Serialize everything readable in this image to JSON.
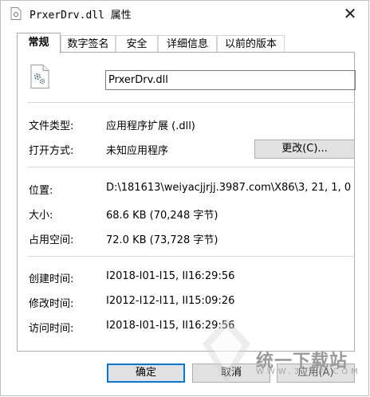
{
  "window": {
    "title_file": "PrxerDrv.dll",
    "title_suffix": "属性",
    "close_glyph": "✕"
  },
  "tabs": [
    {
      "label": "常规",
      "active": true
    },
    {
      "label": "数字签名",
      "active": false
    },
    {
      "label": "安全",
      "active": false
    },
    {
      "label": "详细信息",
      "active": false
    },
    {
      "label": "以前的版本",
      "active": false
    }
  ],
  "general": {
    "file_name": "PrxerDrv.dll",
    "file_icon": "dll-gear-file-icon",
    "rows": {
      "file_type": {
        "label": "文件类型:",
        "value": "应用程序扩展 (.dll)"
      },
      "open_with": {
        "label": "打开方式:",
        "value": "未知应用程序",
        "button": "更改(C)..."
      },
      "location": {
        "label": "位置:",
        "value": "D:\\181613\\weiyacjjrjj.3987.com\\X86\\3, 21, 1, 0"
      },
      "size": {
        "label": "大小:",
        "value": "68.6 KB (70,248 字节)"
      },
      "size_on_disk": {
        "label": "占用空间:",
        "value": "72.0 KB (73,728 字节)"
      },
      "created": {
        "label": "创建时间:",
        "value": "I2018-I01-I15, II16:29:56"
      },
      "modified": {
        "label": "修改时间:",
        "value": "I2012-I12-I11, II15:09:26"
      },
      "accessed": {
        "label": "访问时间:",
        "value": "I2018-I01-I15, II16:29:56"
      }
    }
  },
  "buttons": {
    "ok": "确定",
    "cancel": "取消",
    "apply": "应用(A)"
  },
  "watermark": {
    "text": "统一下载站",
    "subtext": "WWW.3987.COM"
  }
}
